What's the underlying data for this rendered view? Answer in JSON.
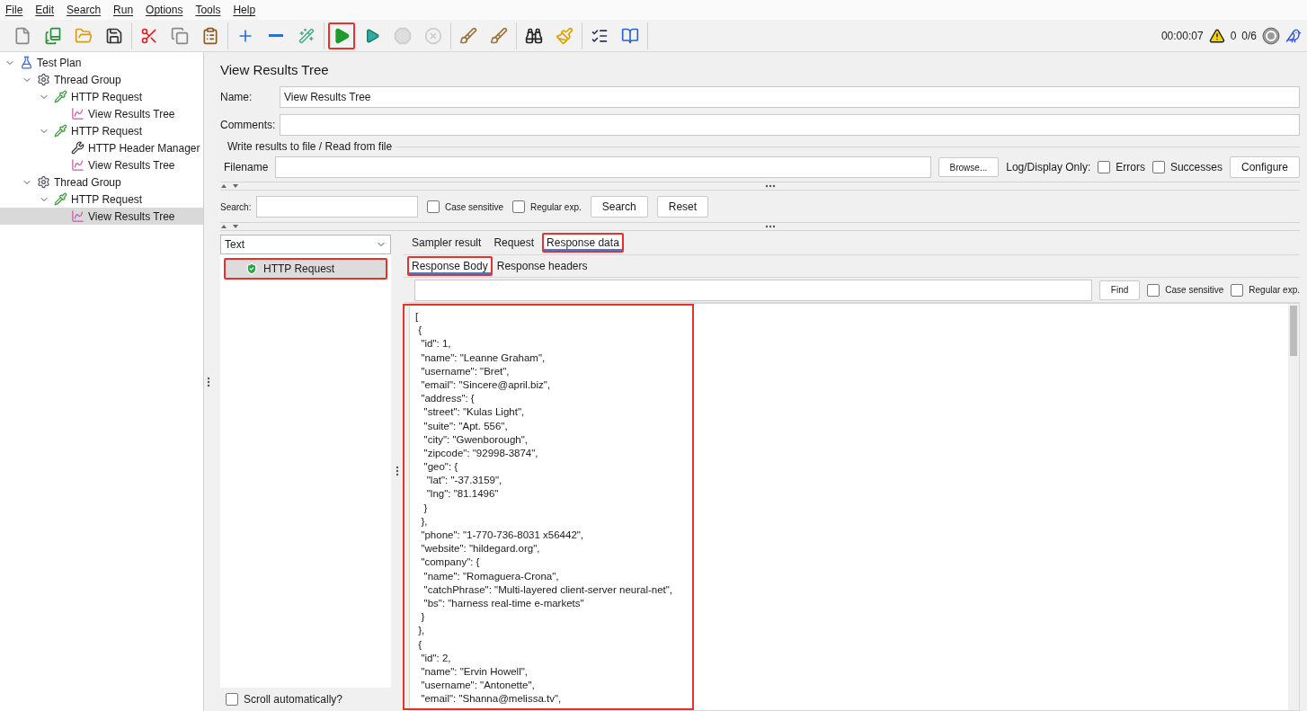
{
  "menu": [
    "File",
    "Edit",
    "Search",
    "Run",
    "Options",
    "Tools",
    "Help"
  ],
  "toolbar": [
    [
      {
        "kind": "new",
        "disabled": false,
        "highlighted": false
      },
      {
        "kind": "templates",
        "disabled": false,
        "highlighted": false
      },
      {
        "kind": "open",
        "disabled": false,
        "highlighted": false
      },
      {
        "kind": "save",
        "disabled": false,
        "highlighted": false
      }
    ],
    [
      {
        "kind": "cut",
        "disabled": false,
        "highlighted": false
      },
      {
        "kind": "copy",
        "disabled": false,
        "highlighted": false
      },
      {
        "kind": "paste",
        "disabled": false,
        "highlighted": false
      }
    ],
    [
      {
        "kind": "expand",
        "disabled": false,
        "highlighted": false
      },
      {
        "kind": "collapse",
        "disabled": false,
        "highlighted": false
      },
      {
        "kind": "toggle",
        "disabled": false,
        "highlighted": false
      }
    ],
    [
      {
        "kind": "start",
        "disabled": false,
        "highlighted": true
      },
      {
        "kind": "start-no-pause",
        "disabled": false,
        "highlighted": false
      },
      {
        "kind": "stop",
        "disabled": true,
        "highlighted": false
      },
      {
        "kind": "shutdown",
        "disabled": true,
        "highlighted": false
      }
    ],
    [
      {
        "kind": "clear",
        "disabled": false,
        "highlighted": false
      },
      {
        "kind": "clear-all",
        "disabled": false,
        "highlighted": false
      }
    ],
    [
      {
        "kind": "search",
        "disabled": false,
        "highlighted": false
      },
      {
        "kind": "reset-search",
        "disabled": false,
        "highlighted": false
      }
    ],
    [
      {
        "kind": "functions",
        "disabled": false,
        "highlighted": false
      },
      {
        "kind": "help",
        "disabled": false,
        "highlighted": false
      }
    ]
  ],
  "status": {
    "timer": "00:00:07",
    "warnings": "0",
    "threads": "0/6"
  },
  "tree": [
    {
      "label": "Test Plan",
      "kind": "plan",
      "expanded": true,
      "selected": false,
      "children": [
        {
          "label": "Thread Group",
          "kind": "threads",
          "expanded": true,
          "selected": false,
          "children": [
            {
              "label": "HTTP Request",
              "kind": "sampler",
              "expanded": true,
              "selected": false,
              "children": [
                {
                  "label": "View Results Tree",
                  "kind": "listener",
                  "selected": false
                }
              ]
            },
            {
              "label": "HTTP Request",
              "kind": "sampler",
              "expanded": true,
              "selected": false,
              "children": [
                {
                  "label": "HTTP Header Manager",
                  "kind": "config",
                  "selected": false
                },
                {
                  "label": "View Results Tree",
                  "kind": "listener",
                  "selected": false
                }
              ]
            }
          ]
        },
        {
          "label": "Thread Group",
          "kind": "threads",
          "expanded": true,
          "selected": false,
          "children": [
            {
              "label": "HTTP Request",
              "kind": "sampler",
              "expanded": true,
              "selected": false,
              "children": [
                {
                  "label": "View Results Tree",
                  "kind": "listener",
                  "selected": true
                }
              ]
            }
          ]
        }
      ]
    }
  ],
  "panel": {
    "title": "View Results Tree",
    "name": {
      "label": "Name:",
      "value": "View Results Tree"
    },
    "comments": {
      "label": "Comments:"
    },
    "file_group": {
      "legend": "Write results to file / Read from file",
      "filename_label": "Filename",
      "browse": "Browse...",
      "log_label": "Log/Display Only:",
      "options": [
        {
          "label": "Errors",
          "checked": false
        },
        {
          "label": "Successes",
          "checked": false
        }
      ],
      "configure": "Configure"
    },
    "search": {
      "label": "Search:",
      "options": [
        {
          "label": "Case sensitive",
          "checked": false
        },
        {
          "label": "Regular exp.",
          "checked": false
        }
      ],
      "buttons": [
        "Search",
        "Reset"
      ]
    }
  },
  "results": {
    "renderer": "Text",
    "items": [
      {
        "label": "HTTP Request",
        "selected": true,
        "highlighted": true
      }
    ],
    "autoscroll": {
      "label": "Scroll automatically?",
      "checked": false
    }
  },
  "tabs": [
    {
      "label": "Sampler result",
      "selected": false,
      "highlighted": false
    },
    {
      "label": "Request",
      "selected": false,
      "highlighted": false
    },
    {
      "label": "Response data",
      "selected": true,
      "highlighted": true
    }
  ],
  "subtabs": [
    {
      "label": "Response Body",
      "selected": true,
      "highlighted": true
    },
    {
      "label": "Response headers",
      "selected": false,
      "highlighted": false
    }
  ],
  "find": {
    "button": "Find",
    "options": [
      {
        "label": "Case sensitive",
        "checked": false
      },
      {
        "label": "Regular exp.",
        "checked": false
      }
    ]
  },
  "body": {
    "highlighted": true,
    "lines": [
      "[",
      " {",
      "  \"id\": 1,",
      "  \"name\": \"Leanne Graham\",",
      "  \"username\": \"Bret\",",
      "  \"email\": \"Sincere@april.biz\",",
      "  \"address\": {",
      "   \"street\": \"Kulas Light\",",
      "   \"suite\": \"Apt. 556\",",
      "   \"city\": \"Gwenborough\",",
      "   \"zipcode\": \"92998-3874\",",
      "   \"geo\": {",
      "    \"lat\": \"-37.3159\",",
      "    \"lng\": \"81.1496\"",
      "   }",
      "  },",
      "  \"phone\": \"1-770-736-8031 x56442\",",
      "  \"website\": \"hildegard.org\",",
      "  \"company\": {",
      "   \"name\": \"Romaguera-Crona\",",
      "   \"catchPhrase\": \"Multi-layered client-server neural-net\",",
      "   \"bs\": \"harness real-time e-markets\"",
      "  }",
      " },",
      " {",
      "  \"id\": 2,",
      "  \"name\": \"Ervin Howell\",",
      "  \"username\": \"Antonette\",",
      "  \"email\": \"Shanna@melissa.tv\","
    ]
  }
}
